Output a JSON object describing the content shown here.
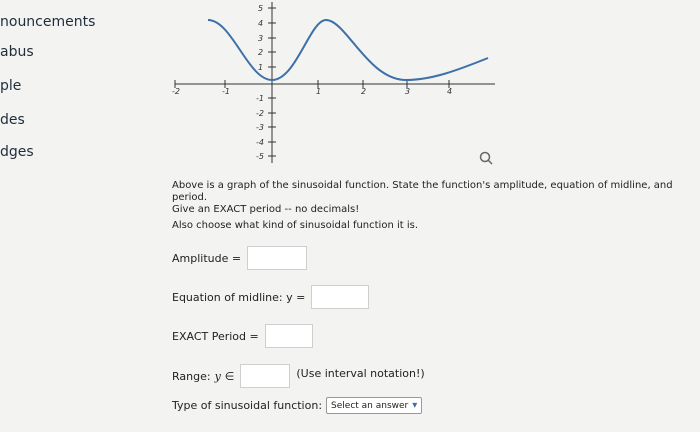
{
  "sidebar": {
    "items": [
      {
        "label": "nouncements"
      },
      {
        "label": "abus"
      },
      {
        "label": "ple"
      },
      {
        "label": "des"
      },
      {
        "label": "dges"
      }
    ]
  },
  "graph": {
    "x_ticks": [
      "-2",
      "-1",
      "1",
      "2",
      "3",
      "4"
    ],
    "y_ticks": [
      "5",
      "4",
      "3",
      "2",
      "1",
      "-1",
      "-2",
      "-3",
      "-4",
      "-5"
    ]
  },
  "question": {
    "prompt_line1": "Above is a graph of the sinusoidal function. State the function's amplitude, equation of midline, and period.",
    "prompt_line2": "Give an EXACT period -- no decimals!",
    "prompt_line3": "Also choose what kind of sinusoidal function it is.",
    "amplitude_label": "Amplitude =",
    "midline_label": "Equation of midline: y =",
    "period_label": "EXACT Period =",
    "range_label": "Range:",
    "range_var": "y",
    "range_symbol": "∈",
    "range_note": "(Use interval notation!)",
    "type_label": "Type of sinusoidal function:",
    "select_value": "Select an answer"
  },
  "colors": {
    "curve": "#3d6fa8",
    "text": "#222222"
  }
}
